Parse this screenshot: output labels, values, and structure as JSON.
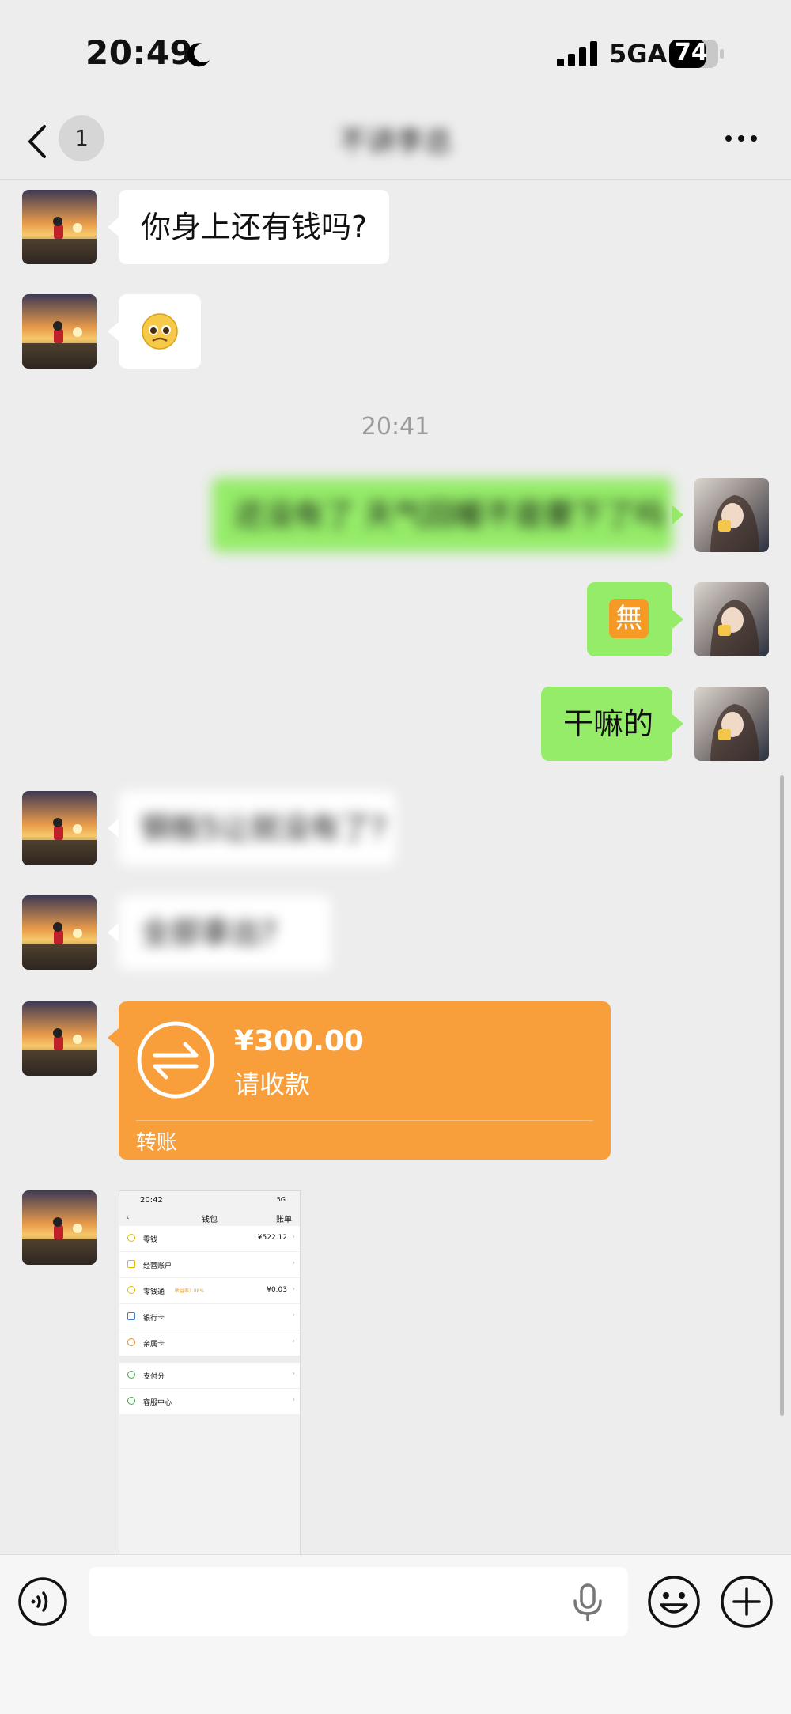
{
  "status_bar": {
    "time": "20:49",
    "network": "5GA",
    "battery": "74"
  },
  "nav": {
    "unread_count": "1",
    "title": "不讲李总"
  },
  "messages": [
    {
      "side": "left",
      "text": "你身上还有钱吗?"
    },
    {
      "side": "left",
      "type": "emoji",
      "icon": "pleading-face-emoji"
    },
    {
      "timestamp": "20:41"
    },
    {
      "side": "right",
      "text": "还没有了 天气回暖不是要下了吗",
      "blurred": true
    },
    {
      "side": "right",
      "type": "emoji",
      "icon": "無",
      "emoji_char": "無"
    },
    {
      "side": "right",
      "text": "干嘛的"
    },
    {
      "side": "left",
      "text": "钢板5让就没有了?",
      "blurred": true
    },
    {
      "side": "left",
      "text": "全部拿出?",
      "blurred": true
    },
    {
      "side": "left",
      "type": "transfer",
      "amount": "¥300.00",
      "note": "请收款",
      "footer": "转账"
    },
    {
      "side": "left",
      "type": "image"
    }
  ],
  "wallet_shot": {
    "time": "20:42",
    "net": "5G",
    "title": "钱包",
    "bill": "账单",
    "rows": [
      {
        "label": "零钱",
        "value": "¥522.12"
      },
      {
        "label": "经营账户",
        "value": ""
      },
      {
        "label": "零钱通",
        "badge": "收益率1.88%",
        "value": "¥0.03"
      },
      {
        "label": "银行卡",
        "value": ""
      },
      {
        "label": "亲属卡",
        "value": ""
      }
    ],
    "rows2": [
      {
        "label": "支付分"
      },
      {
        "label": "客服中心"
      }
    ]
  },
  "colors": {
    "background": "#ededed",
    "bubble_self": "#95ec69",
    "bubble_other": "#ffffff",
    "transfer": "#f89e3a"
  }
}
